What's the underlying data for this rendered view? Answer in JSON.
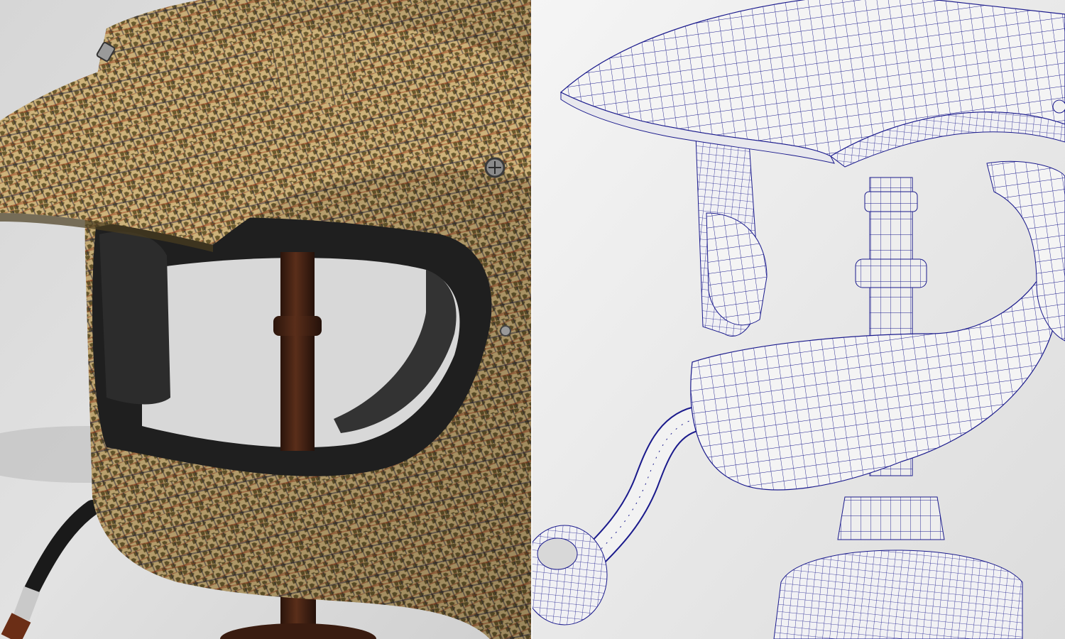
{
  "image": {
    "panels": [
      {
        "name": "textured-render",
        "kind": "rendered helmet with houndstooth texture on wooden stand with pipe"
      },
      {
        "name": "wireframe-render",
        "kind": "white clay render with blue mesh wireframe"
      }
    ],
    "colors": {
      "background": "#e3e3e3",
      "tweed_base": "#cdb27a",
      "tweed_dark": "#5b4a25",
      "tweed_navy": "#2b2a3e",
      "tweed_red": "#8e3a1c",
      "liner": "#2a2a2a",
      "wood": "#3e1f12",
      "wire": "#1a1a8c",
      "clay": "#f4f4f4"
    }
  }
}
